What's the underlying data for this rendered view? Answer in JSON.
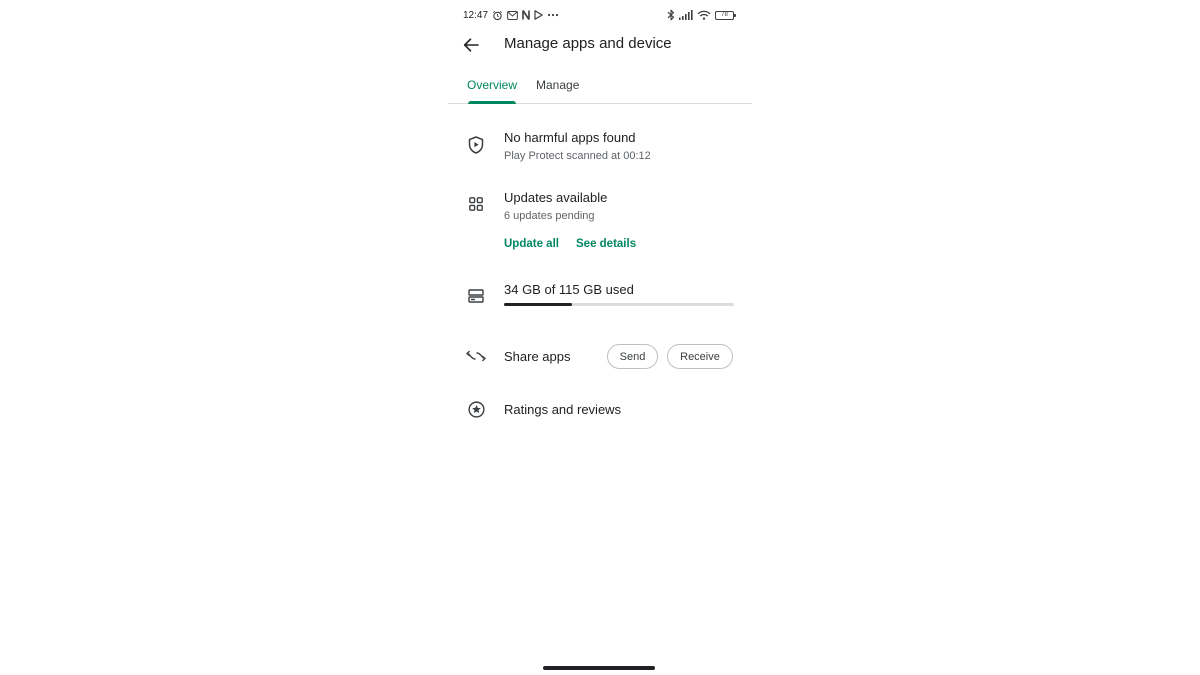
{
  "status_bar": {
    "time": "12:47",
    "battery_level": "78",
    "left_icons": [
      "alarm-icon",
      "gmail-icon",
      "netflix-icon",
      "play-store-icon",
      "more-icon"
    ],
    "right_icons": [
      "bluetooth-icon",
      "signal-icon",
      "wifi-icon",
      "battery-icon"
    ]
  },
  "header": {
    "title": "Manage apps and device"
  },
  "tabs": [
    {
      "label": "Overview",
      "active": true
    },
    {
      "label": "Manage",
      "active": false
    }
  ],
  "protect": {
    "icon": "shield-play-icon",
    "title": "No harmful apps found",
    "subtitle": "Play Protect scanned at 00:12"
  },
  "updates": {
    "icon": "apps-grid-icon",
    "title": "Updates available",
    "subtitle": "6 updates pending",
    "update_all_label": "Update all",
    "see_details_label": "See details"
  },
  "storage": {
    "icon": "storage-icon",
    "label": "34 GB of 115 GB used",
    "used_gb": 34,
    "total_gb": 115
  },
  "share": {
    "icon": "share-apps-icon",
    "title": "Share apps",
    "send_label": "Send",
    "receive_label": "Receive"
  },
  "ratings": {
    "icon": "star-circle-icon",
    "title": "Ratings and reviews"
  },
  "colors": {
    "accent": "#01875f",
    "text_primary": "#202124",
    "text_secondary": "#5f6368",
    "divider": "#dadce0"
  }
}
